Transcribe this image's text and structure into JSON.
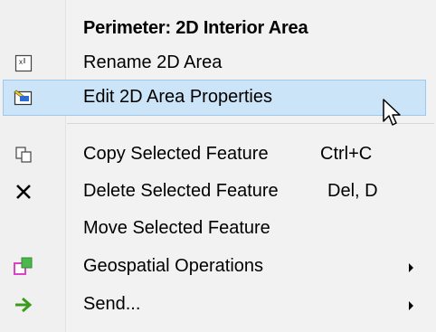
{
  "menu": {
    "header": "Perimeter: 2D Interior Area",
    "items": [
      {
        "label": "Rename 2D Area",
        "shortcut": "",
        "icon": "rename-area-icon",
        "submenu": false
      },
      {
        "label": "Edit 2D Area Properties",
        "shortcut": "",
        "icon": "edit-area-properties-icon",
        "submenu": false,
        "highlighted": true
      },
      {
        "label": "Copy Selected Feature",
        "shortcut": "Ctrl+C",
        "icon": "copy-icon",
        "submenu": false
      },
      {
        "label": "Delete Selected Feature",
        "shortcut": "Del, D",
        "icon": "delete-x-icon",
        "submenu": false
      },
      {
        "label": "Move Selected Feature",
        "shortcut": "",
        "icon": "",
        "submenu": false
      },
      {
        "label": "Geospatial Operations",
        "shortcut": "",
        "icon": "geospatial-operations-icon",
        "submenu": true
      },
      {
        "label": "Send...",
        "shortcut": "",
        "icon": "send-arrow-icon",
        "submenu": true
      }
    ]
  },
  "colors": {
    "highlight_bg": "#cce4f7",
    "highlight_border": "#9dc9ee",
    "menu_bg": "#f2f2f2",
    "send_arrow": "#3a9b1f",
    "geo_magenta": "#e040c8",
    "geo_green": "#4cb84c"
  }
}
